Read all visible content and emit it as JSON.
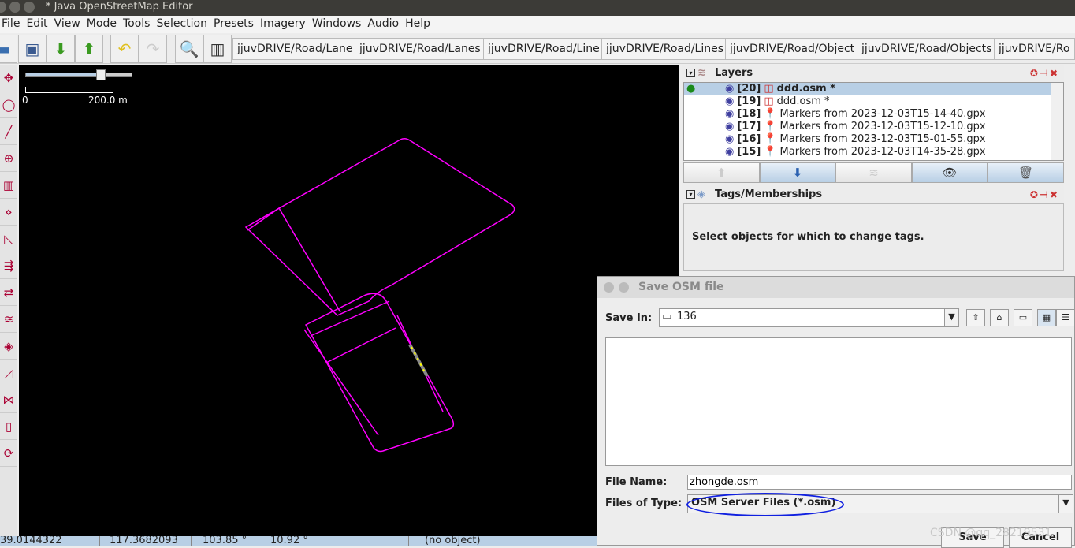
{
  "window": {
    "title": "* Java OpenStreetMap Editor"
  },
  "menu": [
    "File",
    "Edit",
    "View",
    "Mode",
    "Tools",
    "Selection",
    "Presets",
    "Imagery",
    "Windows",
    "Audio",
    "Help"
  ],
  "toolbar": {
    "buttons": [
      "open-icon",
      "save-icon",
      "download-icon",
      "upload-icon",
      "undo-icon",
      "redo-icon",
      "zoom-icon",
      "preferences-icon"
    ],
    "presets": [
      "jjuvDRIVE/Road/Lane",
      "jjuvDRIVE/Road/Lanes",
      "jjuvDRIVE/Road/Line",
      "jjuvDRIVE/Road/Lines",
      "jjuvDRIVE/Road/Object",
      "jjuvDRIVE/Road/Objects",
      "jjuvDRIVE/Ro"
    ]
  },
  "map": {
    "scale_start": "0",
    "scale_end": "200.0 m",
    "zoom_slider": 0.7,
    "way_color": "#ff00ff"
  },
  "layers": {
    "title": "Layers",
    "items": [
      {
        "num": "[20]",
        "name": "ddd.osm *",
        "type": "osm",
        "active": true,
        "selected": true
      },
      {
        "num": "[19]",
        "name": "ddd.osm *",
        "type": "osm"
      },
      {
        "num": "[18]",
        "name": "Markers from 2023-12-03T15-14-40.gpx",
        "type": "marker"
      },
      {
        "num": "[17]",
        "name": "Markers from 2023-12-03T15-12-10.gpx",
        "type": "marker"
      },
      {
        "num": "[16]",
        "name": "Markers from 2023-12-03T15-01-55.gpx",
        "type": "marker"
      },
      {
        "num": "[15]",
        "name": "Markers from 2023-12-03T14-35-28.gpx",
        "type": "marker"
      }
    ]
  },
  "tags": {
    "title": "Tags/Memberships",
    "empty": "Select objects for which to change tags."
  },
  "status": {
    "lat": "39.0144322",
    "lon": "117.3682093",
    "heading": "103.85 °",
    "angle": "10.92 °",
    "object": "(no object)"
  },
  "dialog": {
    "title": "Save OSM file",
    "save_in_label": "Save In:",
    "save_in": "136",
    "file_name_label": "File Name:",
    "file_name": "zhongde.osm",
    "type_label": "Files of Type:",
    "type": "OSM Server Files (*.osm)",
    "save": "Save",
    "cancel": "Cancel"
  },
  "watermark": "CSDN @qq_28219531"
}
